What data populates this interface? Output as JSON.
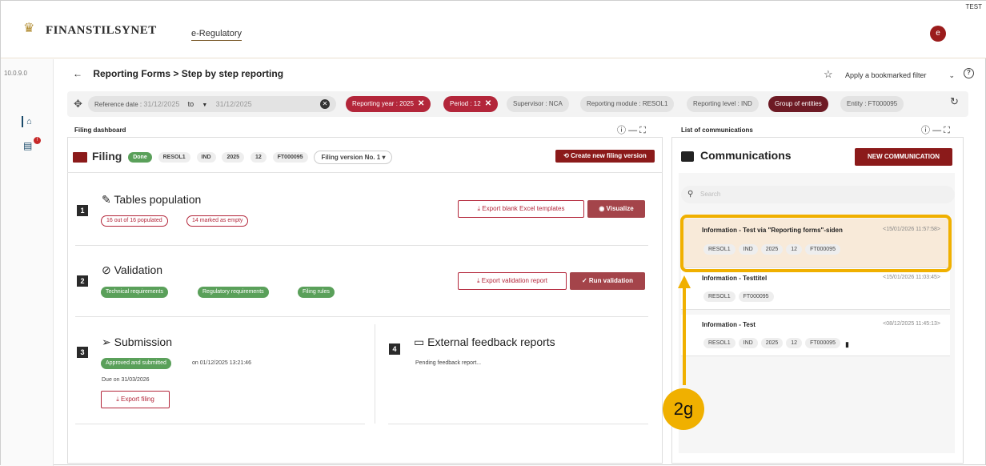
{
  "app": {
    "logo_text": "FINANSTILSYNET",
    "app_link": "e-Regulatory",
    "test_tag": "TEST",
    "user_initial": "e",
    "version": "10.0.9.0"
  },
  "breadcrumb": {
    "back": "←",
    "text": "Reporting Forms > Step by step reporting"
  },
  "bookmark": {
    "label": "Apply a bookmarked filter",
    "chevron": "⌄"
  },
  "filters": {
    "ref_label": "Reference date :",
    "date_from": "31/12/2025",
    "to": "to",
    "date_to": "31/12/2025",
    "chips": [
      {
        "label": "Reporting year : 2025",
        "style": "red",
        "x": "✕"
      },
      {
        "label": "Period : 12",
        "style": "red",
        "x": "✕"
      },
      {
        "label": "Supervisor : NCA",
        "style": "grey"
      },
      {
        "label": "Reporting module : RESOL1",
        "style": "grey"
      },
      {
        "label": "Reporting level : IND",
        "style": "grey"
      },
      {
        "label": "Group of entities",
        "style": "dark"
      },
      {
        "label": "Entity : FT000095",
        "style": "grey"
      }
    ]
  },
  "filing_dashboard": {
    "title": "Filing dashboard",
    "header": {
      "label": "Filing",
      "status": "Done",
      "tags": [
        "RESOL1",
        "IND",
        "2025",
        "12",
        "FT000095"
      ],
      "version": "Filing version No. 1",
      "create_btn": "Create new filing version"
    },
    "tables": {
      "num": "1",
      "title": "Tables population",
      "pills": [
        "16 out of 16 populated",
        "14 marked as empty"
      ],
      "export_btn": "Export blank Excel templates",
      "visualize_btn": "Visualize"
    },
    "validation": {
      "num": "2",
      "title": "Validation",
      "pills": [
        "Technical requirements",
        "Regulatory requirements",
        "Filing rules"
      ],
      "export_btn": "Export validation report",
      "run_btn": "Run validation"
    },
    "submission": {
      "num": "3",
      "title": "Submission",
      "status": "Approved and submitted",
      "on": "on 01/12/2025 13:21:46",
      "due": "Due on 31/03/2026",
      "export_btn": "Export filing"
    },
    "feedback": {
      "num": "4",
      "title": "External feedback reports",
      "text": "Pending feedback report..."
    }
  },
  "communications": {
    "panel_title": "List of communications",
    "title": "Communications",
    "new_btn": "NEW COMMUNICATION",
    "search_placeholder": "Search",
    "items": [
      {
        "title": "Information - Test via \"Reporting forms\"-siden",
        "date": "<15/01/2026 11:57:58>",
        "tags": [
          "RESOL1",
          "IND",
          "2025",
          "12",
          "FT000095"
        ]
      },
      {
        "title": "Information - Testtitel",
        "date": "<15/01/2026 11:03:45>",
        "tags": [
          "RESOL1",
          "FT000095"
        ]
      },
      {
        "title": "Information - Test",
        "date": "<08/12/2025 11:45:13>",
        "tags": [
          "RESOL1",
          "IND",
          "2025",
          "12",
          "FT000095"
        ]
      }
    ]
  },
  "annotation": {
    "label": "2g",
    "color": "#f0b000"
  }
}
